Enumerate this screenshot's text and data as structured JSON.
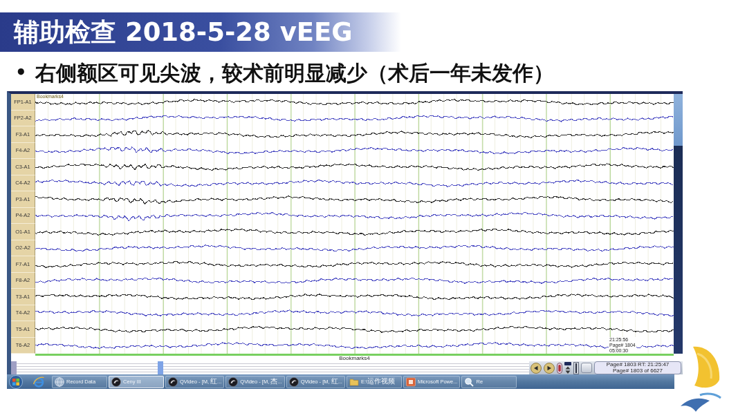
{
  "slide": {
    "title": "辅助检查 2018-5-28 vEEG",
    "bullets": [
      {
        "marker": "•",
        "text": "右侧额区可见尖波，较术前明显减少（术后一年未发作）"
      }
    ]
  },
  "eeg_viewer": {
    "top_bookmark": "Bookmarks4",
    "channels": [
      {
        "label": "FP1-A1",
        "color": "#2e2e2e"
      },
      {
        "label": "FP2-A2",
        "color": "#4d4dc4"
      },
      {
        "label": "F3-A1",
        "color": "#2e2e2e"
      },
      {
        "label": "F4-A2",
        "color": "#4d4dc4"
      },
      {
        "label": "C3-A1",
        "color": "#2e2e2e"
      },
      {
        "label": "C4-A2",
        "color": "#4d4dc4"
      },
      {
        "label": "P3-A1",
        "color": "#2e2e2e"
      },
      {
        "label": "P4-A2",
        "color": "#4d4dc4"
      },
      {
        "label": "O1-A1",
        "color": "#2e2e2e"
      },
      {
        "label": "O2-A2",
        "color": "#4d4dc4"
      },
      {
        "label": "F7-A1",
        "color": "#2e2e2e"
      },
      {
        "label": "F8-A2",
        "color": "#4d4dc4"
      },
      {
        "label": "T3-A1",
        "color": "#2e2e2e"
      },
      {
        "label": "T4-A2",
        "color": "#4d4dc4"
      },
      {
        "label": "T5-A1",
        "color": "#2e2e2e"
      },
      {
        "label": "T6-A2",
        "color": "#4d4dc4"
      }
    ],
    "page_marker": [
      "21:25:56",
      "Page# 1804",
      "05:00:30"
    ],
    "bottom_bookmark": "Bookmarks4",
    "status_lines": [
      "Page# 1803 RT: 21:25:47",
      "Page# 1803 of 6627"
    ]
  },
  "taskbar": {
    "items": [
      {
        "kind": "globe",
        "label": "Record Data",
        "selected": false
      },
      {
        "kind": "disc",
        "label": "Ceny III",
        "selected": true
      },
      {
        "kind": "disc",
        "label": "QVideo - [M, 红...",
        "selected": false
      },
      {
        "kind": "disc",
        "label": "QVideo - [M, 杰...",
        "selected": false
      },
      {
        "kind": "disc",
        "label": "QVideo - [M, 红...",
        "selected": false
      },
      {
        "kind": "folder",
        "label": "E:\\运作视频",
        "selected": false
      },
      {
        "kind": "slides",
        "label": "Microsoft Powe...",
        "selected": false
      },
      {
        "kind": "search",
        "label": "Re",
        "selected": false
      }
    ]
  }
}
